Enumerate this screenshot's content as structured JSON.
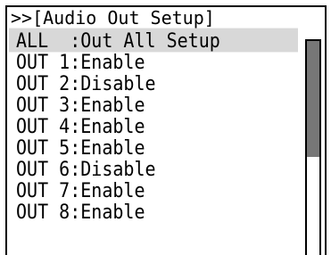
{
  "menu": {
    "title": ">>[Audio Out Setup]",
    "selected_index": 0,
    "items": [
      {
        "label": "ALL  :Out All Setup"
      },
      {
        "label": "OUT 1:Enable"
      },
      {
        "label": "OUT 2:Disable"
      },
      {
        "label": "OUT 3:Enable"
      },
      {
        "label": "OUT 4:Enable"
      },
      {
        "label": "OUT 5:Enable"
      },
      {
        "label": "OUT 6:Disable"
      },
      {
        "label": "OUT 7:Enable"
      },
      {
        "label": "OUT 8:Enable"
      }
    ]
  },
  "scrollbar": {
    "thumb_fraction": 0.54,
    "thumb_color": "#777777"
  },
  "colors": {
    "selected_background": "#d8d8d8",
    "border": "#000000"
  }
}
